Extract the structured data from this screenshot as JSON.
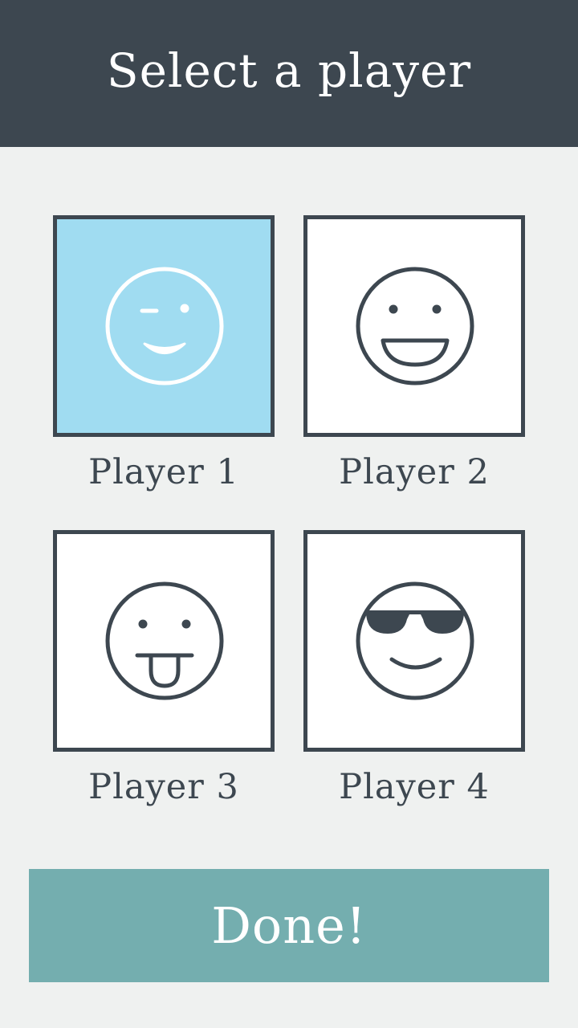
{
  "header": {
    "title": "Select a player"
  },
  "players": [
    {
      "label": "Player 1",
      "avatar_icon": "wink-face-icon",
      "selected": true
    },
    {
      "label": "Player 2",
      "avatar_icon": "grin-face-icon",
      "selected": false
    },
    {
      "label": "Player 3",
      "avatar_icon": "tongue-face-icon",
      "selected": false
    },
    {
      "label": "Player 4",
      "avatar_icon": "sunglasses-face-icon",
      "selected": false
    }
  ],
  "done_button": {
    "label": "Done!"
  },
  "colors": {
    "header_bg": "#3d4750",
    "page_bg": "#eff1f0",
    "selected_tile_bg": "#a0dcf1",
    "tile_border": "#3d4750",
    "done_bg": "#74aeaf"
  }
}
